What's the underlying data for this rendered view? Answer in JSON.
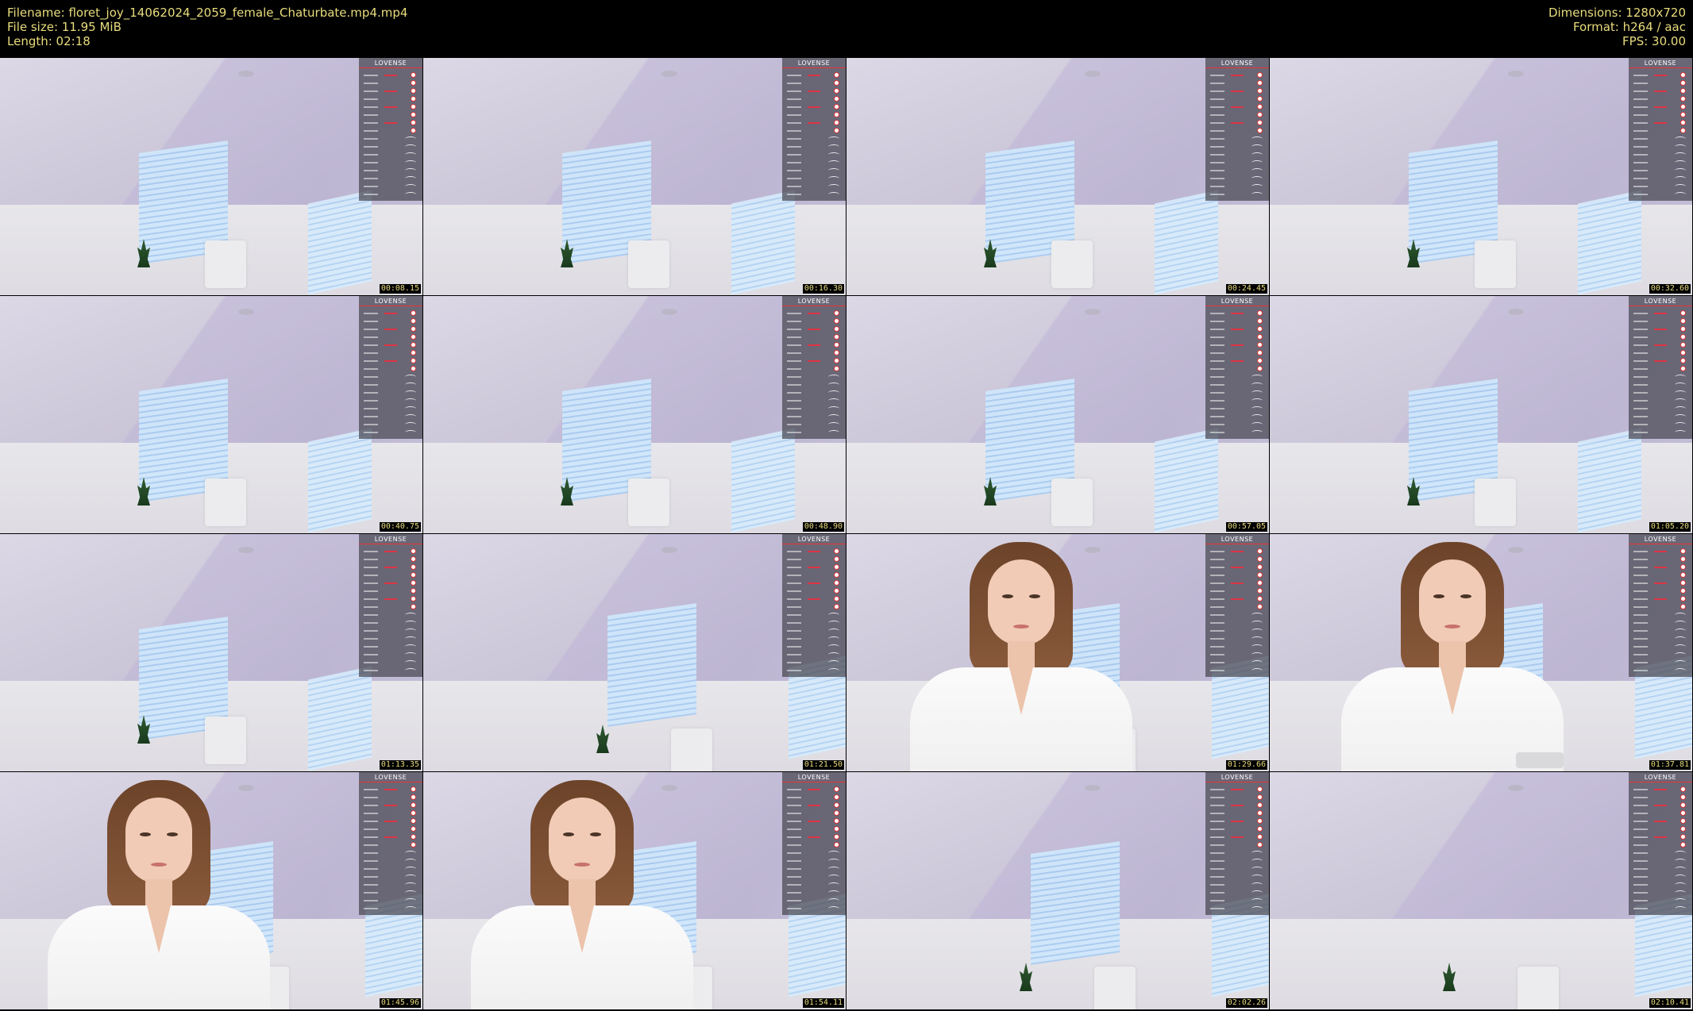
{
  "header": {
    "filename_label": "Filename: floret_joy_14062024_2059_female_Chaturbate.mp4.mp4",
    "filesize_label": "File size: 11.95 MiB",
    "length_label": "Length: 02:18",
    "dimensions_label": "Dimensions: 1280x720",
    "format_label": "Format: h264 / aac",
    "fps_label": "FPS: 30.00"
  },
  "overlay": {
    "brand": "LOVENSE"
  },
  "thumbnails": [
    {
      "timestamp": "00:08.15",
      "person": false
    },
    {
      "timestamp": "00:16.30",
      "person": false
    },
    {
      "timestamp": "00:24.45",
      "person": false
    },
    {
      "timestamp": "00:32.60",
      "person": false
    },
    {
      "timestamp": "00:40.75",
      "person": false
    },
    {
      "timestamp": "00:48.90",
      "person": false
    },
    {
      "timestamp": "00:57.05",
      "person": false
    },
    {
      "timestamp": "01:05.20",
      "person": false
    },
    {
      "timestamp": "01:13.35",
      "person": false
    },
    {
      "timestamp": "01:21.50",
      "person": false
    },
    {
      "timestamp": "01:29.66",
      "person": true
    },
    {
      "timestamp": "01:37.81",
      "person": true
    },
    {
      "timestamp": "01:45.96",
      "person": true
    },
    {
      "timestamp": "01:54.11",
      "person": true
    },
    {
      "timestamp": "02:02.26",
      "person": false
    },
    {
      "timestamp": "02:10.41",
      "person": false
    }
  ],
  "colors": {
    "header_text": "#e8dc7c",
    "background": "#000000",
    "overlay_accent": "#dd3344"
  }
}
